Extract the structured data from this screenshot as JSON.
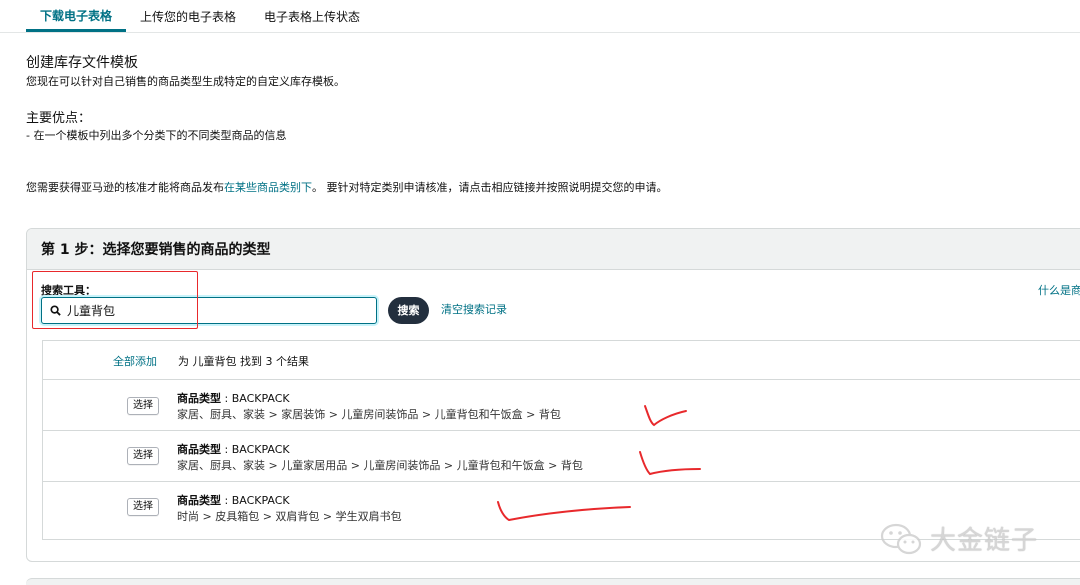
{
  "tabs": [
    {
      "label": "下载电子表格",
      "active": true
    },
    {
      "label": "上传您的电子表格",
      "active": false
    },
    {
      "label": "电子表格上传状态",
      "active": false
    }
  ],
  "intro": {
    "title": "创建库存文件模板",
    "desc": "您现在可以针对自己销售的商品类型生成特定的自定义库存模板。",
    "benefits_title": "主要优点：",
    "benefit_1": "- 在一个模板中列出多个分类下的不同类型商品的信息",
    "approval_prefix": "您需要获得亚马逊的核准才能将商品发布",
    "approval_link": "在某些商品类别下",
    "approval_suffix": "。 要针对特定类别申请核准，请点击相应链接并按照说明提交您的申请。"
  },
  "step1": {
    "heading": "第 1 步：选择您要销售的商品的类型",
    "search_label": "搜索工具：",
    "search_value": "儿童背包",
    "search_button": "搜索",
    "clear_link": "清空搜索记录",
    "whatis_link": "什么是商"
  },
  "results": {
    "add_all": "全部添加",
    "summary": "为 儿童背包 找到 3 个结果",
    "select_label": "选择",
    "type_label": "商品类型",
    "items": [
      {
        "type": "BACKPACK",
        "path": "家居、厨具、家装 > 家居装饰 > 儿童房间装饰品 > 儿童背包和午饭盒 > 背包"
      },
      {
        "type": "BACKPACK",
        "path": "家居、厨具、家装 > 儿童家居用品 > 儿童房间装饰品 > 儿童背包和午饭盒 > 背包"
      },
      {
        "type": "BACKPACK",
        "path": "时尚 > 皮具箱包 > 双肩背包 > 学生双肩书包"
      }
    ]
  },
  "watermark": "大金链子",
  "colors": {
    "link": "#007185",
    "annotation": "#e8292c",
    "button_dark": "#232f3e"
  }
}
